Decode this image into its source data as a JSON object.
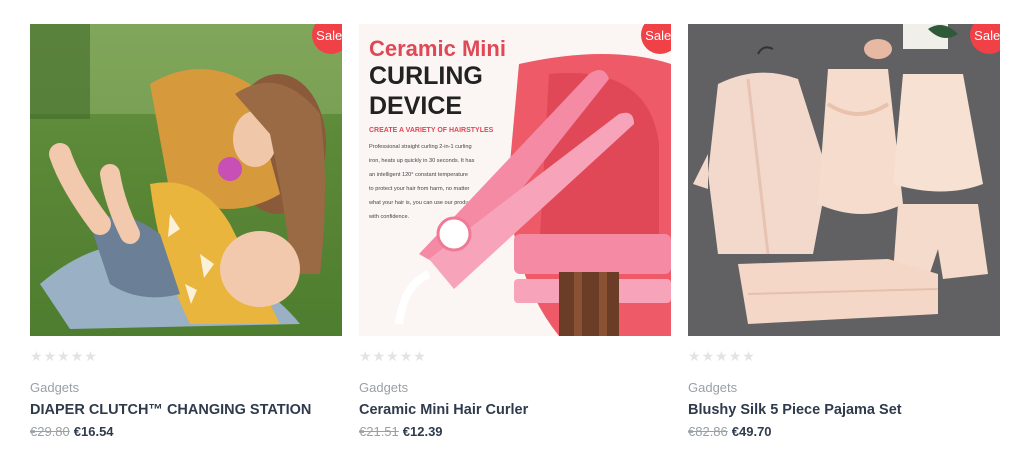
{
  "colors": {
    "sale_badge": "#ef4146",
    "title": "#2f3b4c",
    "muted": "#9aa0a6",
    "star_empty": "#e3e3e3"
  },
  "products": [
    {
      "badge": "Sale!",
      "rating": 0,
      "category": "Gadgets",
      "title": "DIAPER CLUTCH™ CHANGING STATION",
      "old_price": "€29.80",
      "price": "€16.54"
    },
    {
      "badge": "Sale!",
      "rating": 0,
      "category": "Gadgets",
      "title": "Ceramic Mini Hair Curler",
      "old_price": "€21.51",
      "price": "€12.39",
      "image_text": {
        "heading1": "Ceramic Mini",
        "heading2": "CURLING",
        "heading3": "DEVICE",
        "subheading": "CREATE A VARIETY OF HAIRSTYLES",
        "body_lines": [
          "Professional straight curling 2-in-1 curling",
          "iron, heats up quickly in 30 seconds. It has",
          "an intelligent 120° constant temperature",
          "to protect your hair from harm, no matter",
          "what your hair is, you can use our products",
          "with confidence."
        ]
      }
    },
    {
      "badge": "Sale!",
      "rating": 0,
      "category": "Gadgets",
      "title": "Blushy Silk 5 Piece Pajama Set",
      "old_price": "€82.86",
      "price": "€49.70"
    }
  ]
}
